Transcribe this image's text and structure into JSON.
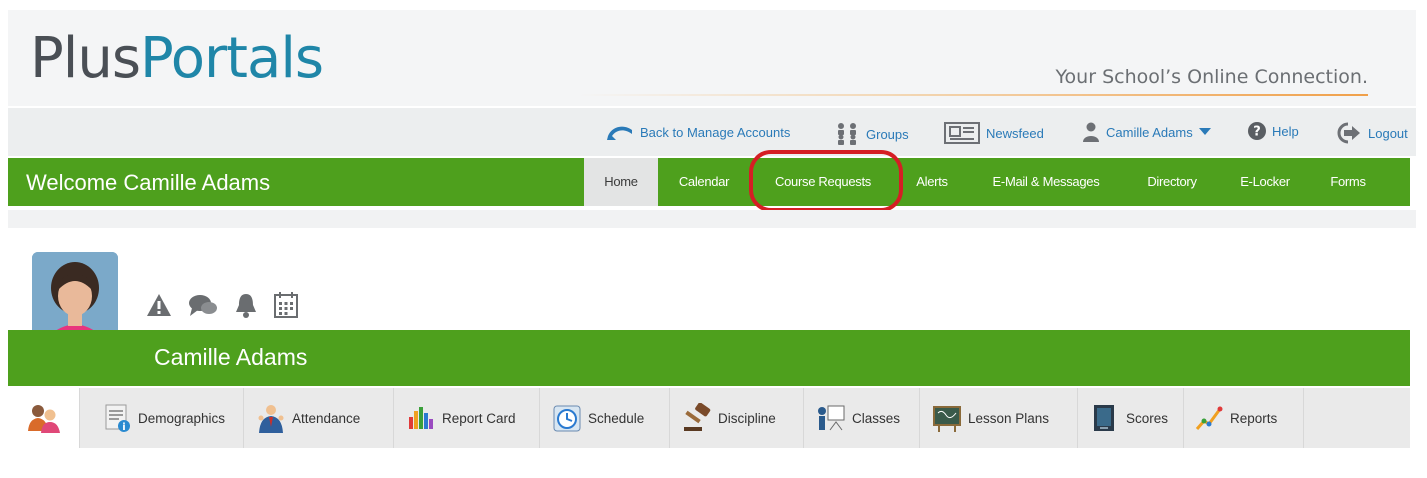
{
  "brand": {
    "logo_part1": "Plus",
    "logo_part2": "Portals",
    "tagline": "Your School’s Online Connection."
  },
  "utility_bar": {
    "back_label": "Back to Manage Accounts",
    "groups_label": "Groups",
    "newsfeed_label": "Newsfeed",
    "user_label": "Camille Adams",
    "help_label": "Help",
    "logout_label": "Logout"
  },
  "main_nav": {
    "welcome": "Welcome Camille Adams",
    "items": [
      {
        "label": "Home",
        "active": true
      },
      {
        "label": "Calendar"
      },
      {
        "label": "Course Requests",
        "highlighted": true
      },
      {
        "label": "Alerts"
      },
      {
        "label": "E-Mail & Messages"
      },
      {
        "label": "Directory"
      },
      {
        "label": "E-Locker"
      },
      {
        "label": "Forms"
      }
    ]
  },
  "student": {
    "name": "Camille Adams"
  },
  "quick_icons": [
    "warning-icon",
    "chat-bubbles-icon",
    "bell-icon",
    "calendar-icon"
  ],
  "tabs": [
    {
      "label": "Demographics",
      "icon": "demographics-icon"
    },
    {
      "label": "Attendance",
      "icon": "attendance-icon"
    },
    {
      "label": "Report Card",
      "icon": "report-card-icon"
    },
    {
      "label": "Schedule",
      "icon": "schedule-icon"
    },
    {
      "label": "Discipline",
      "icon": "gavel-icon"
    },
    {
      "label": "Classes",
      "icon": "classes-icon"
    },
    {
      "label": "Lesson Plans",
      "icon": "lesson-plans-icon"
    },
    {
      "label": "Scores",
      "icon": "scores-icon"
    },
    {
      "label": "Reports",
      "icon": "reports-icon"
    }
  ],
  "colors": {
    "green": "#4ea01d",
    "link_blue": "#2a7ab8",
    "logo_blue": "#1f86a8",
    "highlight_red": "#d51e24"
  }
}
